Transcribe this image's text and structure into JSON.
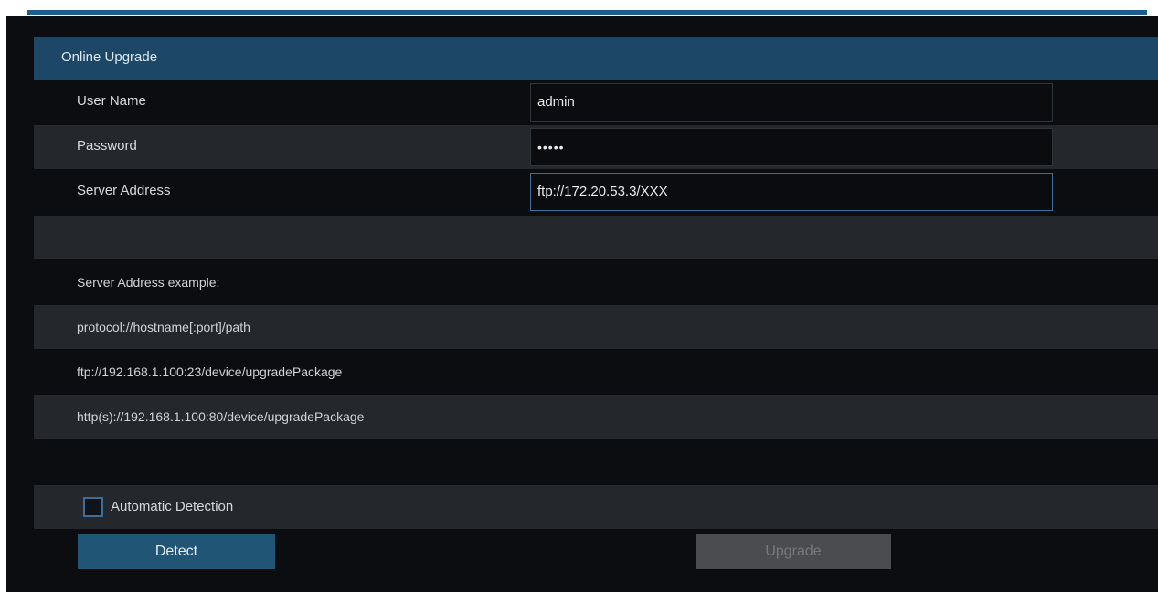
{
  "header": {
    "title": "Online Upgrade"
  },
  "form": {
    "username_label": "User Name",
    "username_value": "admin",
    "password_label": "Password",
    "password_value": "•••••",
    "server_label": "Server Address",
    "server_value": "ftp://172.20.53.3/XXX"
  },
  "examples": {
    "heading": "Server Address example:",
    "lines": [
      "protocol://hostname[:port]/path",
      "ftp://192.168.1.100:23/device/upgradePackage",
      "http(s)://192.168.1.100:80/device/upgradePackage"
    ]
  },
  "options": {
    "auto_detect_label": "Automatic Detection",
    "auto_detect_checked": false
  },
  "buttons": {
    "detect_label": "Detect",
    "upgrade_label": "Upgrade"
  },
  "colors": {
    "header_bg": "#1c4766",
    "panel_bg": "#0b0d10",
    "alt_row_bg": "#24272c",
    "primary_button": "#215576",
    "disabled_button": "#4a4c50",
    "focus_border": "#3b6f9b"
  }
}
